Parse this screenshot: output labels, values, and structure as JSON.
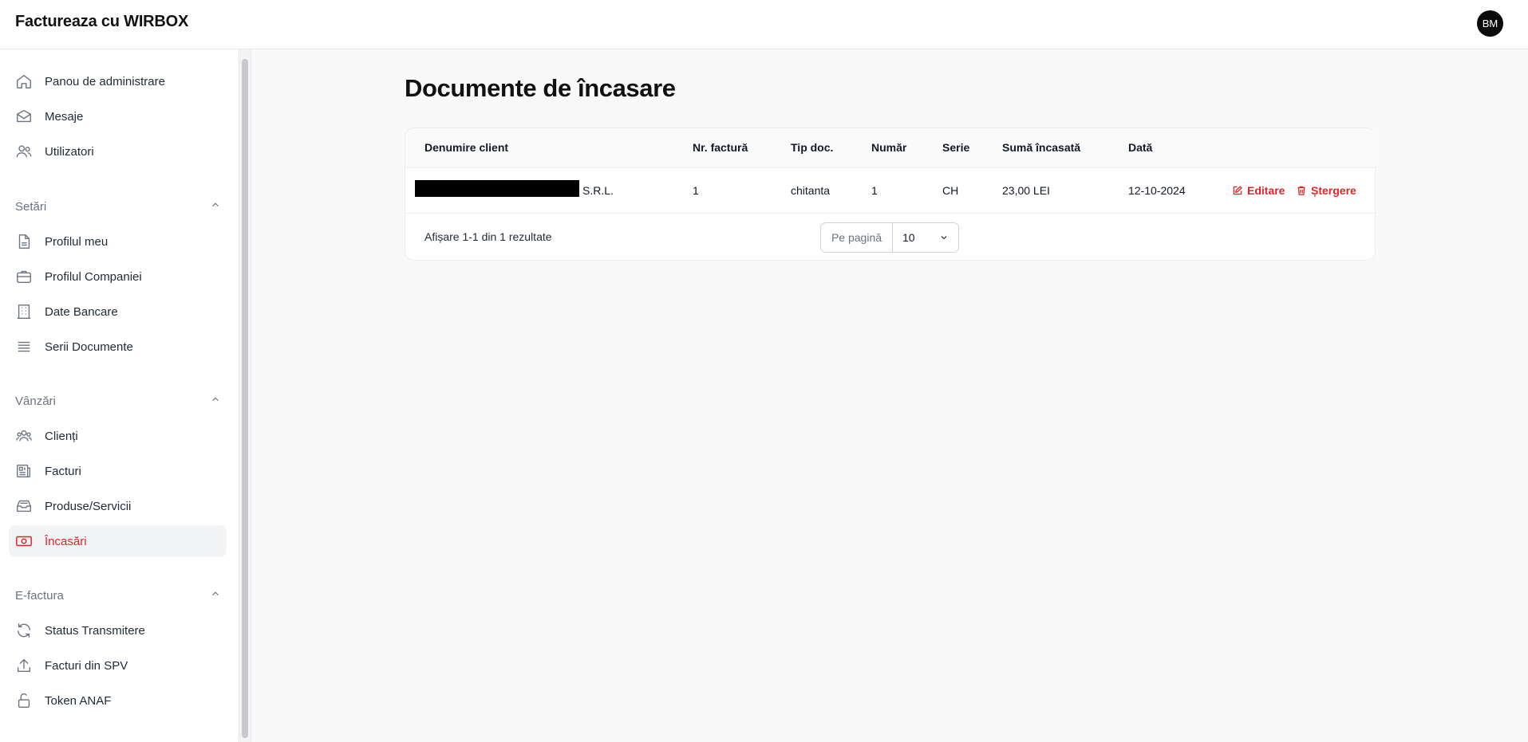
{
  "app": {
    "title": "Factureaza cu WIRBOX",
    "user_initials": "BM"
  },
  "sidebar": {
    "top_items": [
      {
        "label": "Panou de administrare",
        "icon": "home-icon"
      },
      {
        "label": "Mesaje",
        "icon": "mail-icon"
      },
      {
        "label": "Utilizatori",
        "icon": "users-icon"
      }
    ],
    "sections": [
      {
        "title": "Setări",
        "items": [
          {
            "label": "Profilul meu",
            "icon": "document-icon"
          },
          {
            "label": "Profilul Companiei",
            "icon": "briefcase-icon"
          },
          {
            "label": "Date Bancare",
            "icon": "building-icon"
          },
          {
            "label": "Serii Documente",
            "icon": "list-icon"
          }
        ]
      },
      {
        "title": "Vânzări",
        "items": [
          {
            "label": "Clienți",
            "icon": "user-group-icon"
          },
          {
            "label": "Facturi",
            "icon": "newspaper-icon"
          },
          {
            "label": "Produse/Servicii",
            "icon": "archive-box-icon"
          },
          {
            "label": "Încasări",
            "icon": "banknotes-icon",
            "active": true
          }
        ]
      },
      {
        "title": "E-factura",
        "items": [
          {
            "label": "Status Transmitere",
            "icon": "refresh-icon"
          },
          {
            "label": "Facturi din SPV",
            "icon": "upload-icon"
          },
          {
            "label": "Token ANAF",
            "icon": "unlock-icon"
          }
        ]
      }
    ]
  },
  "main": {
    "title": "Documente de încasare",
    "table": {
      "headers": [
        "Denumire client",
        "Nr. factură",
        "Tip doc.",
        "Număr",
        "Serie",
        "Sumă încasată",
        "Dată"
      ],
      "rows": [
        {
          "client_suffix": "S.R.L.",
          "invoice_no": "1",
          "doc_type": "chitanta",
          "number": "1",
          "series": "CH",
          "amount": "23,00 LEI",
          "date": "12-10-2024",
          "edit_label": "Editare",
          "delete_label": "Ștergere"
        }
      ]
    },
    "footer": {
      "results_text": "Afișare 1-1 din 1 rezultate",
      "per_page_label": "Pe pagină",
      "per_page_value": "10"
    }
  },
  "colors": {
    "accent": "#dc2626",
    "background": "#f9f9f9",
    "text": "#111827",
    "muted": "#6b7280"
  }
}
